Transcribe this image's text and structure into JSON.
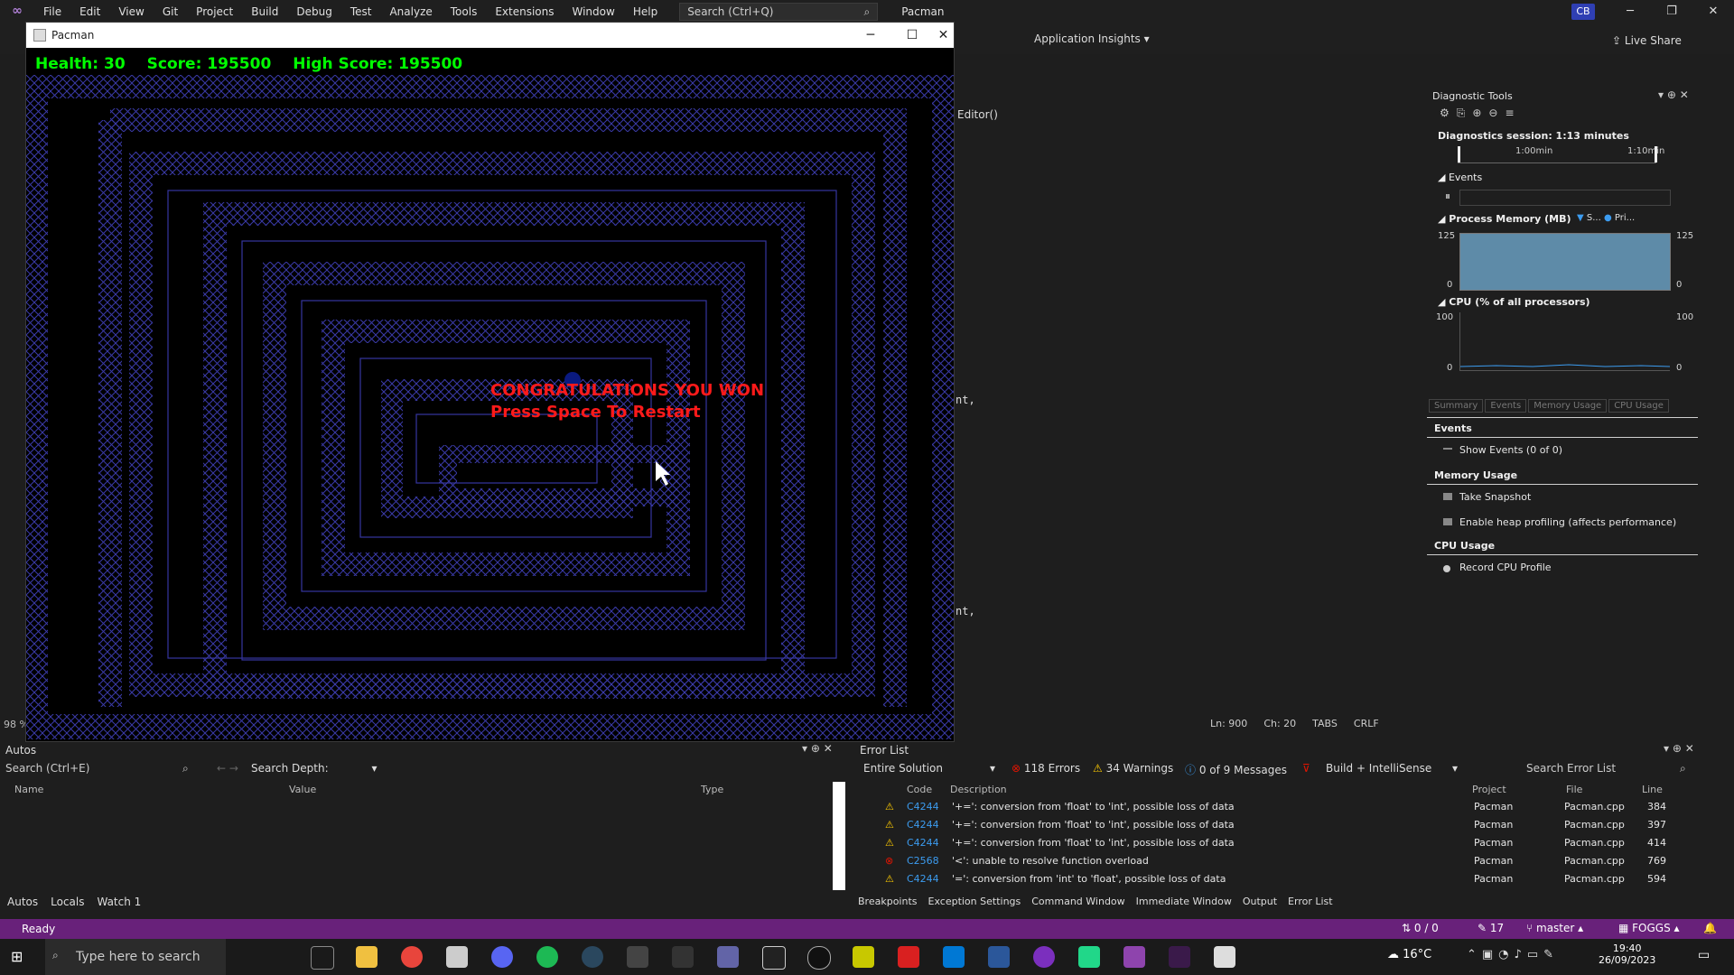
{
  "menu": {
    "items": [
      "File",
      "Edit",
      "View",
      "Git",
      "Project",
      "Build",
      "Debug",
      "Test",
      "Analyze",
      "Tools",
      "Extensions",
      "Window",
      "Help"
    ],
    "search_placeholder": "Search (Ctrl+Q)",
    "solution_title": "Pacman",
    "user_badge": "CB"
  },
  "toolbar": {
    "app_insights": "Application Insights",
    "live_share": "Live Share"
  },
  "editor": {
    "nav_member": "Editor()",
    "fragment_1": "nt,",
    "fragment_2": "nt,",
    "ln": "Ln: 900",
    "ch": "Ch: 20",
    "tabs": "TABS",
    "crlf": "CRLF",
    "zoom": "98 %"
  },
  "game": {
    "window_title": "Pacman",
    "health": "Health: 30",
    "score": "Score: 195500",
    "high_score": "High Score: 195500",
    "message_line1": "CONGRATULATIONS YOU WON",
    "message_line2": "Press Space To Restart"
  },
  "diagnostics": {
    "title": "Diagnostic Tools",
    "session": "Diagnostics session: 1:13 minutes",
    "timeline_label1": "1:00min",
    "timeline_label2": "1:10min",
    "events_header": "Events",
    "process_memory_header": "Process Memory (MB)",
    "memory_legend_1": "S...",
    "memory_legend_2": "Pri...",
    "memory_max_left": "125",
    "memory_min_left": "0",
    "memory_max_right": "125",
    "memory_min_right": "0",
    "cpu_header": "CPU (% of all processors)",
    "cpu_max_left": "100",
    "cpu_min_left": "0",
    "cpu_max_right": "100",
    "cpu_min_right": "0",
    "tabs": [
      "Summary",
      "Events",
      "Memory Usage",
      "CPU Usage"
    ],
    "section_events": "Events",
    "show_events": "Show Events (0 of 0)",
    "section_memory": "Memory Usage",
    "take_snapshot": "Take Snapshot",
    "heap_profiling": "Enable heap profiling (affects performance)",
    "section_cpu": "CPU Usage",
    "record_cpu": "Record CPU Profile"
  },
  "autos": {
    "title": "Autos",
    "search_placeholder": "Search (Ctrl+E)",
    "search_depth": "Search Depth:",
    "columns": [
      "Name",
      "Value",
      "Type"
    ],
    "tabs": [
      "Autos",
      "Locals",
      "Watch 1"
    ]
  },
  "errors": {
    "title": "Error List",
    "scope": "Entire Solution",
    "errors_count": "118 Errors",
    "warnings_count": "34 Warnings",
    "messages_count": "0 of 9 Messages",
    "build_filter": "Build + IntelliSense",
    "search_placeholder": "Search Error List",
    "columns": [
      "Code",
      "Description",
      "Project",
      "File",
      "Line"
    ],
    "rows": [
      {
        "kind": "warning",
        "code": "C4244",
        "desc": "'+=': conversion from 'float' to 'int', possible loss of data",
        "project": "Pacman",
        "file": "Pacman.cpp",
        "line": "384"
      },
      {
        "kind": "warning",
        "code": "C4244",
        "desc": "'+=': conversion from 'float' to 'int', possible loss of data",
        "project": "Pacman",
        "file": "Pacman.cpp",
        "line": "397"
      },
      {
        "kind": "warning",
        "code": "C4244",
        "desc": "'+=': conversion from 'float' to 'int', possible loss of data",
        "project": "Pacman",
        "file": "Pacman.cpp",
        "line": "414"
      },
      {
        "kind": "error",
        "code": "C2568",
        "desc": "'<': unable to resolve function overload",
        "project": "Pacman",
        "file": "Pacman.cpp",
        "line": "769"
      },
      {
        "kind": "warning",
        "code": "C4244",
        "desc": "'=': conversion from 'int' to 'float', possible loss of data",
        "project": "Pacman",
        "file": "Pacman.cpp",
        "line": "594"
      }
    ],
    "tabs": [
      "Breakpoints",
      "Exception Settings",
      "Command Window",
      "Immediate Window",
      "Output",
      "Error List"
    ]
  },
  "status": {
    "ready": "Ready",
    "changes": "0 / 0",
    "pencil_count": "17",
    "branch": "master",
    "repo": "FOGGS"
  },
  "taskbar": {
    "search_placeholder": "Type here to search",
    "temperature": "16°C",
    "time": "19:40",
    "date": "26/09/2023"
  }
}
